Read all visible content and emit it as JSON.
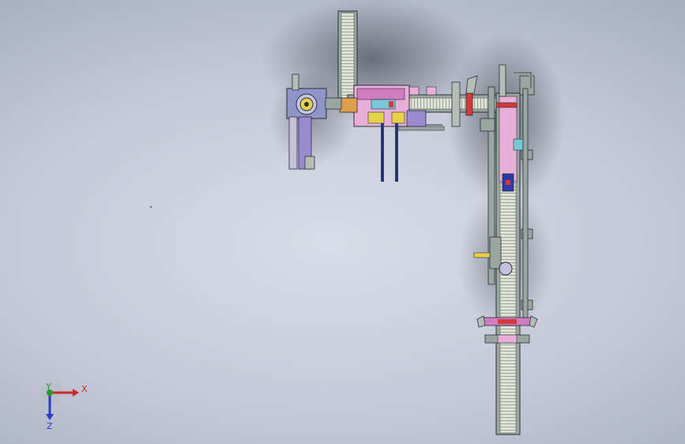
{
  "viewport": {
    "background": "#c4cad8",
    "model": {
      "name": "conveyor-assembly",
      "colors": {
        "frame": "#9aa7a0",
        "belt": "#d9dcd2",
        "outline": "#2b2f3a",
        "magenta": "#d07cc0",
        "red": "#d23a3a",
        "blue": "#2e3aa8",
        "orange": "#e0a04a",
        "yellow": "#e6d24a",
        "green": "#7fcf84",
        "purple": "#9a8ad0",
        "pink": "#e8b0d8",
        "cyan": "#78c8d8"
      }
    },
    "triad": {
      "x_label": "X",
      "y_label": "Y",
      "z_label": "Z",
      "x_color": "#cc2a2a",
      "y_color": "#2a9a2a",
      "z_color": "#2a3ad0"
    }
  }
}
